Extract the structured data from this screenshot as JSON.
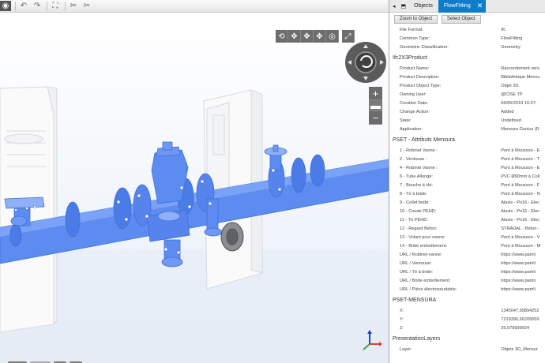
{
  "panel": {
    "tabs": [
      {
        "label": "Objects"
      },
      {
        "label": "FlowFitting",
        "close": "✕"
      }
    ],
    "buttons": {
      "zoom": "Zoom to Object",
      "select": "Select Object"
    },
    "top_rows": [
      {
        "k": "File Format:",
        "v": "Ifc"
      },
      {
        "k": "Common Type:",
        "v": "FlowFitting"
      },
      {
        "k": "Geometric Classification:",
        "v": "Geometry"
      }
    ],
    "sections": [
      {
        "title": "Ifc2X3Product",
        "rows": [
          {
            "k": "Product Name:",
            "v": "Raccordement vers"
          },
          {
            "k": "Product Description:",
            "v": "Bibliothèque Mensu"
          },
          {
            "k": "Product Object Type:",
            "v": "Objet 3D"
          },
          {
            "k": "Owning User:",
            "v": "@CISE TP"
          },
          {
            "k": "Creation Date:",
            "v": "06/05/2019 15:27:"
          },
          {
            "k": "Change Action:",
            "v": "Added"
          },
          {
            "k": "State:",
            "v": "Undefined"
          },
          {
            "k": "Application:",
            "v": "Mensura Genius (R"
          }
        ]
      },
      {
        "title": "PSET - Attributs Mensura",
        "rows": [
          {
            "k": "1 - Robinet Vanne :",
            "v": "Pont à Mousson - E"
          },
          {
            "k": "2 - Ventouse :",
            "v": "Pont à Mousson - T"
          },
          {
            "k": "4 - Robinet Vanne :",
            "v": "Pont à Mousson - E"
          },
          {
            "k": "6 - Tube Allongé:",
            "v": "PVC Ø90mm à Coll"
          },
          {
            "k": "7 - Bouche à clé:",
            "v": "Pont à Mousson - F"
          },
          {
            "k": "8 - Té à bride:",
            "v": "Pont à Mousson - N"
          },
          {
            "k": "9 - Collet bride:",
            "v": "Alaxis - Pn16 - Elec"
          },
          {
            "k": "10 - Coude PEHD:",
            "v": "Alaxis - Pn16 - Elec"
          },
          {
            "k": "11 - Té PEHD:",
            "v": "Alaxis - Pn16 - Elec"
          },
          {
            "k": "12 - Regard Béton:",
            "v": "STRADAL - Béton -"
          },
          {
            "k": "13 - Volant pour vanne:",
            "v": "Pont à Mousson - V"
          },
          {
            "k": "14 - Bride emboîtement:",
            "v": "Pont à Mousson - M"
          },
          {
            "k": "URL / Robinet-vanne:",
            "v": "https://www.pamli"
          },
          {
            "k": "URL / Ventouse:",
            "v": "https://www.pamli"
          },
          {
            "k": "URL / Té à bride:",
            "v": "https://www.pamli"
          },
          {
            "k": "URL / Bride emboîtement:",
            "v": "https://www.pamli"
          },
          {
            "k": "URL / Pièce électrosoudable:",
            "v": "https://www.pamli"
          }
        ]
      },
      {
        "title": "PSET-MENSURA",
        "rows": [
          {
            "k": "X:",
            "v": "1345047,99894252"
          },
          {
            "k": "Y:",
            "v": "7219396,66205659"
          },
          {
            "k": "Z:",
            "v": "25,079999924"
          }
        ]
      },
      {
        "title": "PresentationLayers",
        "rows": [
          {
            "k": "Layer:",
            "v": "Objets 3D_Mensur"
          }
        ]
      }
    ]
  },
  "viewport": {
    "object_color": "#5c8cf0",
    "selected_color": "#6f7378",
    "axis": {
      "x": "#e53935",
      "y": "#43a047",
      "z": "#1e3fd6"
    }
  }
}
